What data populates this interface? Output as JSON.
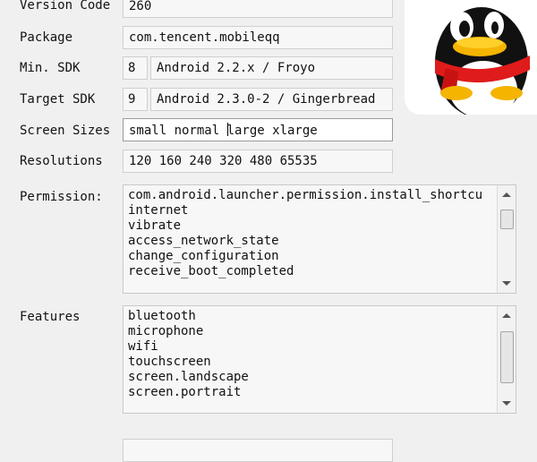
{
  "fields": {
    "version_code": {
      "label": "Version Code",
      "value": "260"
    },
    "package": {
      "label": "Package",
      "value": "com.tencent.mobileqq"
    },
    "min_sdk": {
      "label": "Min. SDK",
      "level": "8",
      "name": "Android 2.2.x / Froyo"
    },
    "target_sdk": {
      "label": "Target SDK",
      "level": "9",
      "name": "Android 2.3.0-2 / Gingerbread"
    },
    "screen_sizes": {
      "label": "Screen Sizes",
      "value_before_caret": "small normal ",
      "value_after_caret": "large xlarge"
    },
    "resolutions": {
      "label": "Resolutions",
      "value": "120 160 240 320 480 65535"
    },
    "permission": {
      "label": "Permission:",
      "items": [
        "com.android.launcher.permission.install_shortcu",
        "internet",
        "vibrate",
        "access_network_state",
        "change_configuration",
        "receive_boot_completed"
      ]
    },
    "features": {
      "label": "Features",
      "items": [
        "bluetooth",
        "microphone",
        "wifi",
        "touchscreen",
        "screen.landscape",
        "screen.portrait"
      ]
    }
  },
  "app_icon": "qq-penguin-icon"
}
